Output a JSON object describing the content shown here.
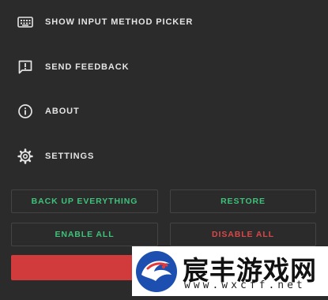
{
  "menu": {
    "items": [
      {
        "label": "SHOW INPUT METHOD PICKER",
        "icon": "keyboard-icon"
      },
      {
        "label": "SEND FEEDBACK",
        "icon": "feedback-icon"
      },
      {
        "label": "ABOUT",
        "icon": "info-icon"
      },
      {
        "label": "SETTINGS",
        "icon": "gear-icon"
      }
    ]
  },
  "actions": {
    "backup_label": "BACK UP EVERYTHING",
    "restore_label": "RESTORE",
    "enable_all_label": "ENABLE ALL",
    "disable_all_label": "DISABLE ALL"
  },
  "watermark": {
    "title": "宸丰游戏网",
    "url": "www.wxcff.net"
  },
  "colors": {
    "background": "#2b2b2b",
    "text": "#e4e4e4",
    "positive": "#3fc27a",
    "negative": "#d94848",
    "danger_bar": "#d23b3b"
  }
}
